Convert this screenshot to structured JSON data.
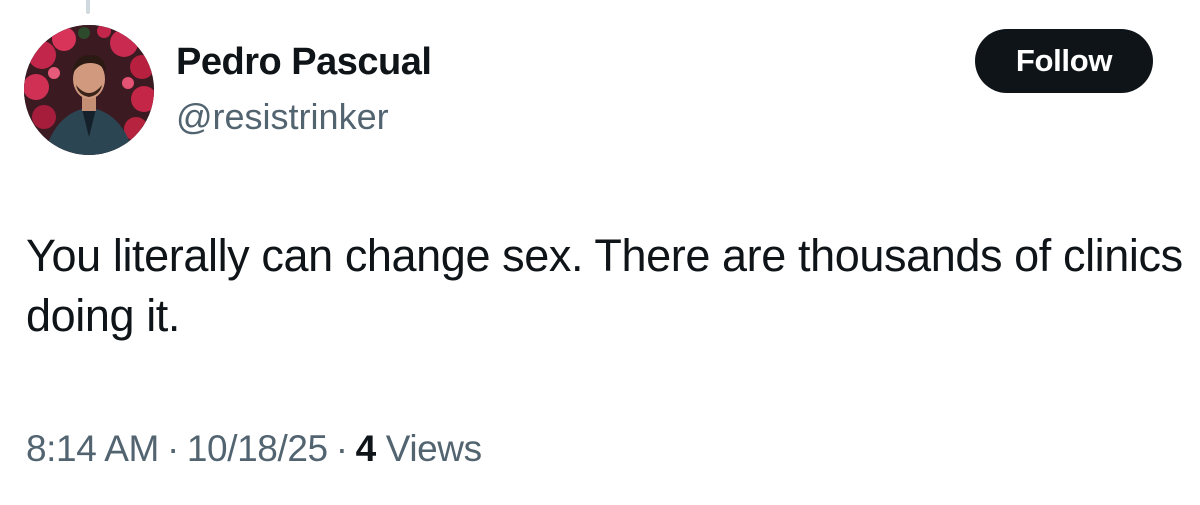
{
  "tweet": {
    "author": {
      "display_name": "Pedro Pascual",
      "handle": "@resistrinker"
    },
    "follow_label": "Follow",
    "text": "You literally can change sex. There are thousands of clinics doing it.",
    "meta": {
      "time": "8:14 AM",
      "separator": "·",
      "date": "10/18/25",
      "views_count": "4",
      "views_label": "Views"
    }
  },
  "colors": {
    "text_primary": "#0f1419",
    "text_secondary": "#536471",
    "follow_bg": "#0f1419",
    "follow_text": "#ffffff"
  }
}
